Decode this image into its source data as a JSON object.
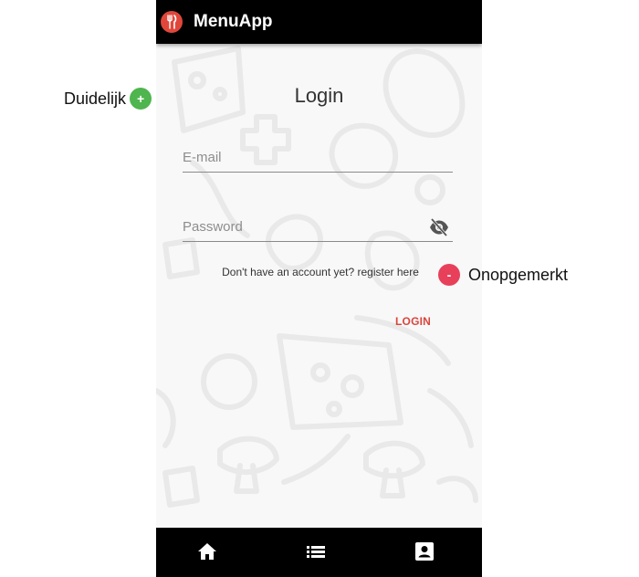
{
  "app": {
    "title": "MenuApp",
    "logo_icon": "utensils-icon",
    "brand_color": "#e0473b"
  },
  "login": {
    "title": "Login",
    "email_placeholder": "E-mail",
    "password_placeholder": "Password",
    "register_text": "Don't have an account yet? register here",
    "login_button": "LOGIN",
    "accent_color": "#d9453d"
  },
  "bottom_nav": {
    "items": [
      {
        "icon": "home-icon"
      },
      {
        "icon": "list-icon"
      },
      {
        "icon": "account-box-icon"
      }
    ]
  },
  "annotations": {
    "positive": {
      "label": "Duidelijk",
      "badge": "+",
      "color": "#4fb54e"
    },
    "negative": {
      "label": "Onopgemerkt",
      "badge": "-",
      "color": "#e8405a"
    }
  }
}
